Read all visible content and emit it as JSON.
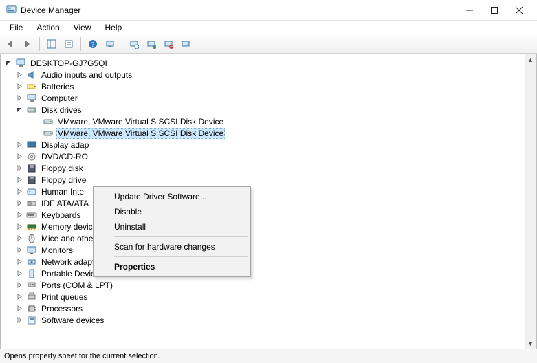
{
  "titlebar": {
    "title": "Device Manager"
  },
  "menubar": {
    "items": [
      "File",
      "Action",
      "View",
      "Help"
    ]
  },
  "root_node": "DESKTOP-GJ7G5QI",
  "tree": [
    {
      "label": "Audio inputs and outputs",
      "expanded": false,
      "icon": "audio"
    },
    {
      "label": "Batteries",
      "expanded": false,
      "icon": "battery"
    },
    {
      "label": "Computer",
      "expanded": false,
      "icon": "computer"
    },
    {
      "label": "Disk drives",
      "expanded": true,
      "icon": "disk",
      "children": [
        {
          "label": "VMware, VMware Virtual S SCSI Disk Device",
          "icon": "disk",
          "selected": false
        },
        {
          "label": "VMware, VMware Virtual S SCSI Disk Device",
          "icon": "disk",
          "selected": true
        }
      ]
    },
    {
      "label": "Display adapters",
      "truncated": "Display adap",
      "expanded": false,
      "icon": "display"
    },
    {
      "label": "DVD/CD-ROM drives",
      "truncated": "DVD/CD-RO",
      "expanded": false,
      "icon": "dvd"
    },
    {
      "label": "Floppy disk drives",
      "truncated": "Floppy disk",
      "expanded": false,
      "icon": "floppy"
    },
    {
      "label": "Floppy drive controllers",
      "truncated": "Floppy drive",
      "expanded": false,
      "icon": "floppy"
    },
    {
      "label": "Human Interface Devices",
      "truncated": "Human Inte",
      "expanded": false,
      "icon": "hid"
    },
    {
      "label": "IDE ATA/ATAPI controllers",
      "truncated": "IDE ATA/ATA",
      "expanded": false,
      "icon": "ide"
    },
    {
      "label": "Keyboards",
      "expanded": false,
      "icon": "keyboard"
    },
    {
      "label": "Memory devices",
      "expanded": false,
      "icon": "memory"
    },
    {
      "label": "Mice and other pointing devices",
      "expanded": false,
      "icon": "mouse"
    },
    {
      "label": "Monitors",
      "expanded": false,
      "icon": "monitor"
    },
    {
      "label": "Network adapters",
      "expanded": false,
      "icon": "network"
    },
    {
      "label": "Portable Devices",
      "expanded": false,
      "icon": "portable"
    },
    {
      "label": "Ports (COM & LPT)",
      "expanded": false,
      "icon": "port"
    },
    {
      "label": "Print queues",
      "expanded": false,
      "icon": "printer"
    },
    {
      "label": "Processors",
      "expanded": false,
      "icon": "cpu"
    },
    {
      "label": "Software devices",
      "expanded": false,
      "icon": "software"
    }
  ],
  "context_menu": {
    "items": [
      {
        "label": "Update Driver Software..."
      },
      {
        "label": "Disable"
      },
      {
        "label": "Uninstall"
      },
      {
        "sep": true
      },
      {
        "label": "Scan for hardware changes"
      },
      {
        "sep": true
      },
      {
        "label": "Properties",
        "bold": true
      }
    ]
  },
  "statusbar": {
    "text": "Opens property sheet for the current selection."
  }
}
